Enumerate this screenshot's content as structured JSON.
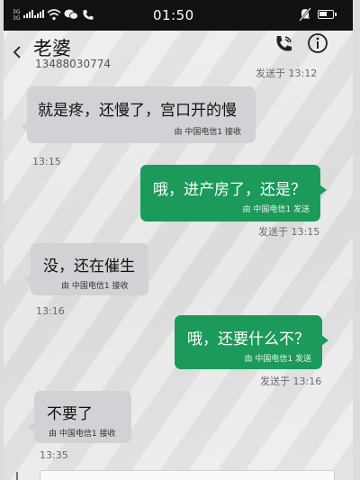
{
  "status_bar": {
    "sim1_label": "3G",
    "sim2_label": "3G",
    "time": "01:50",
    "battery_level": 0.7,
    "icons": [
      "signal-icon",
      "wifi-icon",
      "chat-icon",
      "call-icon",
      "mute-icon",
      "battery-icon"
    ]
  },
  "header": {
    "contact_name": "老婆",
    "contact_number": "13488030774",
    "icons": [
      "back-icon",
      "phone-call-icon",
      "info-icon"
    ]
  },
  "conversation": {
    "top_status": "发送于 13:12",
    "messages": [
      {
        "direction": "in",
        "text": "就是疼，还慢了，宫口开的慢",
        "meta": "由 中国电信1 接收",
        "time": "13:15"
      },
      {
        "direction": "out",
        "text": "哦，进产房了，还是？",
        "meta": "由 中国电信1 发送",
        "time": "发送于 13:15"
      },
      {
        "direction": "in",
        "text": "没，还在催生",
        "meta": "由 中国电信1 接收",
        "time": "13:16"
      },
      {
        "direction": "out",
        "text": "哦，还要什么不？",
        "meta": "由 中国电信1 发送",
        "time": "发送于 13:16"
      },
      {
        "direction": "in",
        "text": "不要了",
        "meta": "由 中国电信1 接收",
        "time": "13:35"
      }
    ]
  },
  "colors": {
    "sent_bubble": "#1b9a5a",
    "received_bubble": "#d2d2d6",
    "status_bar": "#111111"
  }
}
